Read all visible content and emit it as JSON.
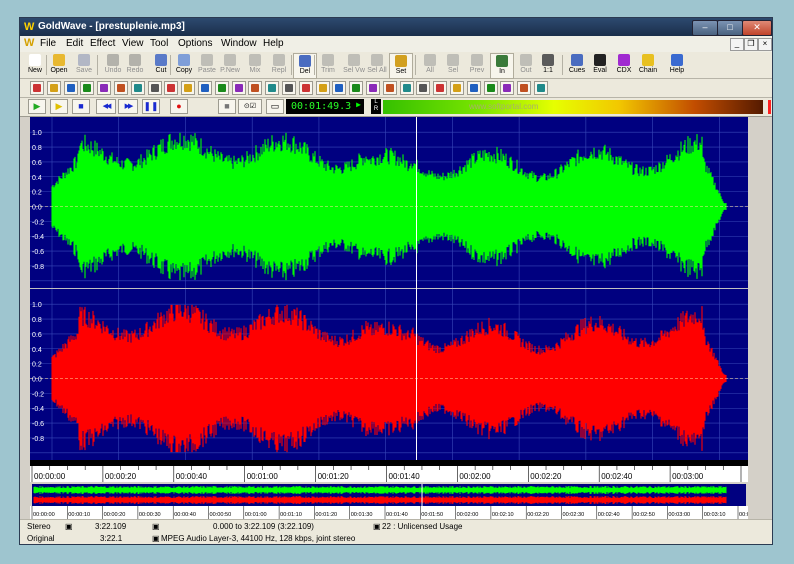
{
  "window": {
    "title": "GoldWave - [prestuplenie.mp3]",
    "logo_letter": "W"
  },
  "menu": {
    "items": [
      {
        "key": "file",
        "label": "File"
      },
      {
        "key": "edit",
        "label": "Edit"
      },
      {
        "key": "effect",
        "label": "Effect"
      },
      {
        "key": "view",
        "label": "View"
      },
      {
        "key": "tool",
        "label": "Tool"
      },
      {
        "key": "options",
        "label": "Options"
      },
      {
        "key": "window",
        "label": "Window"
      },
      {
        "key": "help",
        "label": "Help"
      }
    ]
  },
  "toolbar": [
    {
      "key": "new",
      "label": "New",
      "color": "#ffffff",
      "enabled": true
    },
    {
      "key": "open",
      "label": "Open",
      "color": "#e8b830",
      "enabled": true
    },
    {
      "key": "save",
      "label": "Save",
      "color": "#6c7aa8",
      "enabled": false
    },
    {
      "key": "undo",
      "label": "Undo",
      "color": "#6f6f6f",
      "enabled": false
    },
    {
      "key": "redo",
      "label": "Redo",
      "color": "#6f6f6f",
      "enabled": false
    },
    {
      "key": "cut",
      "label": "Cut",
      "color": "#5a7ac8",
      "enabled": true
    },
    {
      "key": "copy",
      "label": "Copy",
      "color": "#7f9ed8",
      "enabled": true
    },
    {
      "key": "paste",
      "label": "Paste",
      "color": "#8a8a8a",
      "enabled": false
    },
    {
      "key": "pnew",
      "label": "P.New",
      "color": "#8a8a8a",
      "enabled": false
    },
    {
      "key": "mix",
      "label": "Mix",
      "color": "#8a8a8a",
      "enabled": false
    },
    {
      "key": "repl",
      "label": "Repl",
      "color": "#8a8a8a",
      "enabled": false
    },
    {
      "key": "del",
      "label": "Del",
      "color": "#4a6cc0",
      "enabled": true
    },
    {
      "key": "trim",
      "label": "Trim",
      "color": "#8a8a8a",
      "enabled": false
    },
    {
      "key": "selvw",
      "label": "Sel Vw",
      "color": "#8a8a8a",
      "enabled": false
    },
    {
      "key": "selall",
      "label": "Sel All",
      "color": "#8a8a8a",
      "enabled": false
    },
    {
      "key": "set",
      "label": "Set",
      "color": "#d2a020",
      "enabled": true
    },
    {
      "key": "all",
      "label": "All",
      "color": "#8a8a8a",
      "enabled": false
    },
    {
      "key": "sel",
      "label": "Sel",
      "color": "#8a8a8a",
      "enabled": false
    },
    {
      "key": "prev",
      "label": "Prev",
      "color": "#8a8a8a",
      "enabled": false
    },
    {
      "key": "in",
      "label": "In",
      "color": "#3a7a3a",
      "enabled": true
    },
    {
      "key": "out",
      "label": "Out",
      "color": "#8a8a8a",
      "enabled": false
    },
    {
      "key": "ratio",
      "label": "1:1",
      "color": "#5a5a5a",
      "enabled": true
    },
    {
      "key": "cues",
      "label": "Cues",
      "color": "#4a6cc0",
      "enabled": true
    },
    {
      "key": "eval",
      "label": "Eval",
      "color": "#222222",
      "enabled": true
    },
    {
      "key": "cdx",
      "label": "CDX",
      "color": "#a02ad0",
      "enabled": true
    },
    {
      "key": "chain",
      "label": "Chain",
      "color": "#e8c020",
      "enabled": true
    },
    {
      "key": "help",
      "label": "Help",
      "color": "#3a6ad0",
      "enabled": true
    }
  ],
  "effects_toolbar": {
    "icon_colors": [
      "#cc3333",
      "#d4a017",
      "#2060c0",
      "#1a8a1a",
      "#8a2ab8",
      "#c05020",
      "#208a8a",
      "#555555"
    ]
  },
  "transport": {
    "buttons": [
      {
        "key": "play",
        "symbol": "▶",
        "color": "#22aa22"
      },
      {
        "key": "play-selection",
        "symbol": "▶",
        "color": "#e0c000"
      },
      {
        "key": "stop",
        "symbol": "■",
        "color": "#1a2ad0"
      },
      {
        "key": "rewind",
        "symbol": "◀◀",
        "color": "#1a2ad0"
      },
      {
        "key": "fast-forward",
        "symbol": "▶▶",
        "color": "#1a2ad0"
      },
      {
        "key": "pause",
        "symbol": "❚❚",
        "color": "#1a2ad0"
      },
      {
        "key": "record",
        "symbol": "●",
        "color": "#e01010"
      }
    ],
    "time": "00:01:49.3",
    "lr_label": [
      "L",
      "R"
    ],
    "meter_watermark": "www.softportal.com"
  },
  "waveform": {
    "left_channel_color": "#00ff00",
    "right_channel_color": "#ff0000",
    "background_color": "#000080",
    "axis_labels": [
      "1.0",
      "0.8",
      "0.6",
      "0.4",
      "0.2",
      "0.0",
      "-0.2",
      "-0.4",
      "-0.6",
      "-0.8"
    ],
    "playback_position_seconds": 109.3,
    "duration_seconds": 202.109
  },
  "timeline": {
    "labels": [
      "00:00:00",
      "00:00:20",
      "00:00:40",
      "00:01:00",
      "00:01:20",
      "00:01:40",
      "00:02:00",
      "00:02:20",
      "00:02:40",
      "00:03:00"
    ]
  },
  "overview": {
    "labels": [
      "00:00:00",
      "00:00:10",
      "00:00:20",
      "00:00:30",
      "00:00:40",
      "00:00:50",
      "00:01:00",
      "00:01:10",
      "00:01:20",
      "00:01:30",
      "00:01:40",
      "00:01:50",
      "00:02:00",
      "00:02:10",
      "00:02:20",
      "00:02:30",
      "00:02:40",
      "00:02:50",
      "00:03:00",
      "00:03:10",
      "00:0"
    ]
  },
  "status": {
    "channels": "Stereo",
    "length": "3:22.109",
    "selection": "0.000 to 3:22.109 (3:22.109)",
    "license": "22 : Unlicensed Usage",
    "mode": "Original",
    "orig_length": "3:22.1",
    "format": "MPEG Audio Layer-3, 44100 Hz, 128 kbps, joint stereo"
  }
}
